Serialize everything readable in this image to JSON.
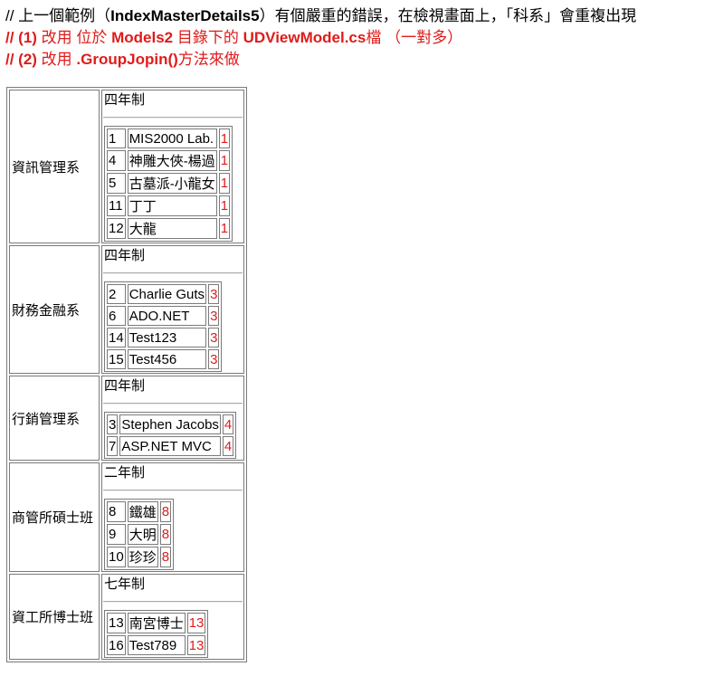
{
  "header": {
    "line1_a": "// 上一個範例（",
    "line1_b": "IndexMasterDetails5",
    "line1_c": "）有個嚴重的錯誤，在檢視畫面上，「科系」會重複出現",
    "line2_a": "// (1)",
    "line2_b": " 改用 位於 ",
    "line2_c": "Models2",
    "line2_d": " 目錄下的 ",
    "line2_e": "UDViewModel.cs",
    "line2_f": "檔 （一對多）",
    "line3_a": "// (2)",
    "line3_b": " 改用 ",
    "line3_c": ".GroupJopin()",
    "line3_d": "方法來做"
  },
  "colors": {
    "accent_red": "#e01b1b",
    "border": "#7a7a7a"
  },
  "departments": [
    {
      "name": "資訊管理系",
      "system": "四年制",
      "students": [
        {
          "id": "1",
          "name": "MIS2000 Lab.",
          "dept_id": "1"
        },
        {
          "id": "4",
          "name": "神雕大俠-楊過",
          "dept_id": "1"
        },
        {
          "id": "5",
          "name": "古墓派-小龍女",
          "dept_id": "1"
        },
        {
          "id": "11",
          "name": "丁丁",
          "dept_id": "1"
        },
        {
          "id": "12",
          "name": "大龍",
          "dept_id": "1"
        }
      ]
    },
    {
      "name": "財務金融系",
      "system": "四年制",
      "students": [
        {
          "id": "2",
          "name": "Charlie Guts",
          "dept_id": "3"
        },
        {
          "id": "6",
          "name": "ADO.NET",
          "dept_id": "3"
        },
        {
          "id": "14",
          "name": "Test123",
          "dept_id": "3"
        },
        {
          "id": "15",
          "name": "Test456",
          "dept_id": "3"
        }
      ]
    },
    {
      "name": "行銷管理系",
      "system": "四年制",
      "students": [
        {
          "id": "3",
          "name": "Stephen Jacobs",
          "dept_id": "4"
        },
        {
          "id": "7",
          "name": "ASP.NET MVC",
          "dept_id": "4"
        }
      ]
    },
    {
      "name": "商管所碩士班",
      "system": "二年制",
      "students": [
        {
          "id": "8",
          "name": "鐵雄",
          "dept_id": "8"
        },
        {
          "id": "9",
          "name": "大明",
          "dept_id": "8"
        },
        {
          "id": "10",
          "name": "珍珍",
          "dept_id": "8"
        }
      ]
    },
    {
      "name": "資工所博士班",
      "system": "七年制",
      "students": [
        {
          "id": "13",
          "name": "南宮博士",
          "dept_id": "13"
        },
        {
          "id": "16",
          "name": "Test789",
          "dept_id": "13"
        }
      ]
    }
  ]
}
